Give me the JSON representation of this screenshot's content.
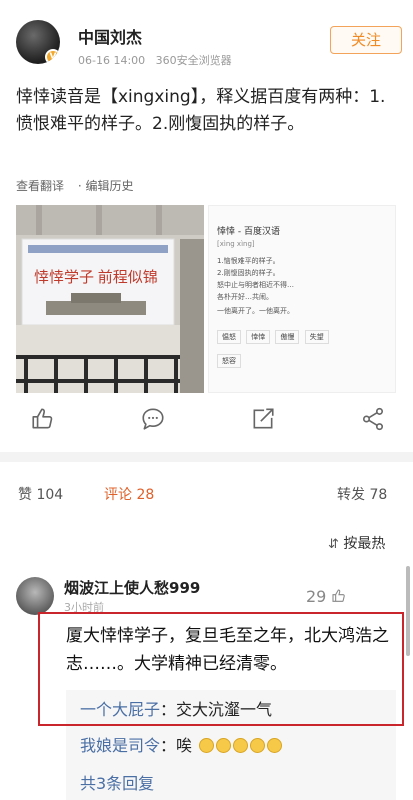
{
  "post": {
    "author": "中国刘杰",
    "time": "06-16 14:00",
    "source": "360安全浏览器",
    "follow_label": "关注",
    "text": "悻悻读音是【xingxing】，释义据百度有两种：1.愤恨难平的样子。2.刚愎固执的样子。",
    "translate_label": "查看翻译",
    "edit_history_label": "· 编辑历史"
  },
  "photo1": {
    "banner_text": "悻悻学子  前程似锦"
  },
  "photo2": {
    "title": "悻悻 - 百度汉语",
    "pinyin": "[xìng xìng]",
    "lines": [
      "1.恼恨难平的样子。",
      "2.刚愎固执的样子。",
      "怒中止与明者相近不得…",
      "各朴开好…共闹。",
      "一他离开了。一他离开。"
    ],
    "tags": [
      "愠怒",
      "悻悻",
      "傲慢",
      "失望"
    ],
    "tag2": "怒容"
  },
  "icons": {
    "like": "thumbs-up-icon",
    "comment": "comment-icon",
    "share": "share-icon",
    "more": "more-share-icon"
  },
  "stats": {
    "likes_label": "赞 104",
    "comments_label": "评论 28",
    "reposts_label": "转发 78"
  },
  "sort_label": "按最热",
  "comment": {
    "author": "烟波江上使人愁999",
    "time": "3小时前",
    "likes": "29",
    "text": "厦大悻悻学子，复旦毛至之年，北大鸿浩之志……。大学精神已经清零。",
    "replies": [
      {
        "who": "一个大屁子",
        "sep": "：",
        "what": "交大沆瀣一气"
      },
      {
        "who": "我娘是司令",
        "sep": "：",
        "what": "唉"
      }
    ],
    "more_replies_label": "共3条回复"
  },
  "colors": {
    "accent": "#f08a24",
    "comments_active": "#e0612a",
    "highlight_box": "#c9252c",
    "link": "#4a6fa5"
  }
}
